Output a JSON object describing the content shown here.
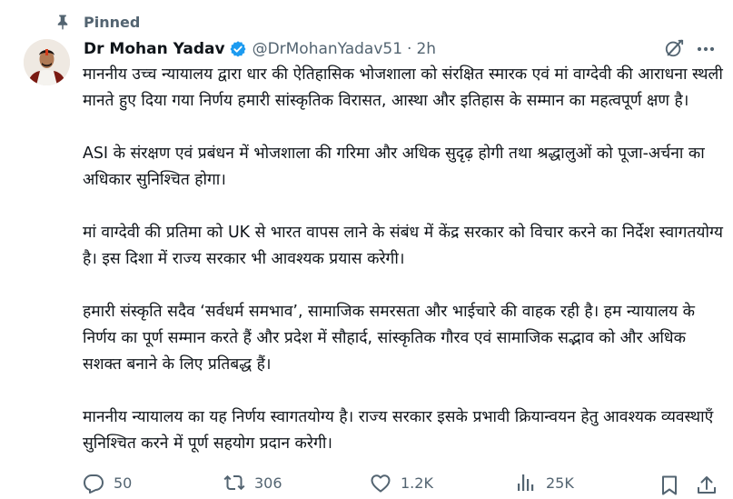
{
  "pinned": {
    "label": "Pinned"
  },
  "author": {
    "name": "Dr Mohan Yadav",
    "handle": "@DrMohanYadav51",
    "separator": "·",
    "time": "2h"
  },
  "tweet": {
    "paragraphs": [
      "माननीय उच्च न्यायालय द्वारा धार की ऐतिहासिक भोजशाला को संरक्षित स्मारक एवं मां वाग्देवी की आराधना स्थली मानते हुए दिया गया निर्णय हमारी सांस्कृतिक विरासत, आस्था और इतिहास के सम्मान का महत्वपूर्ण क्षण है।",
      "ASI के संरक्षण एवं प्रबंधन में भोजशाला की गरिमा और अधिक सुदृढ़ होगी तथा श्रद्धालुओं को पूजा-अर्चना का अधिकार सुनिश्चित होगा।",
      "मां वाग्देवी की प्रतिमा को UK से भारत वापस लाने के संबंध में केंद्र सरकार को विचार करने का निर्देश स्वागतयोग्य है। इस दिशा में राज्य सरकार भी आवश्यक प्रयास करेगी।",
      "हमारी संस्कृति सदैव ‘सर्वधर्म समभाव’, सामाजिक समरसता और भाईचारे की वाहक रही है। हम न्यायालय के निर्णय का पूर्ण सम्मान करते हैं और प्रदेश में सौहार्द, सांस्कृतिक गौरव एवं सामाजिक सद्भाव को और अधिक सशक्त बनाने के लिए प्रतिबद्ध हैं।",
      "माननीय न्यायालय का यह निर्णय स्वागतयोग्य है। राज्य सरकार इसके प्रभावी क्रियान्वयन हेतु आवश्यक व्यवस्थाएँ सुनिश्चित करने में पूर्ण सहयोग प्रदान करेगी।"
    ]
  },
  "actions": {
    "replies": "50",
    "reposts": "306",
    "likes": "1.2K",
    "views": "25K"
  },
  "icons": {
    "pin": "pin-icon",
    "verified": "verified-badge-icon",
    "grok": "grok-icon",
    "more": "more-icon",
    "reply": "reply-icon",
    "repost": "repost-icon",
    "like": "heart-icon",
    "views": "views-icon",
    "bookmark": "bookmark-icon",
    "share": "share-icon"
  },
  "colors": {
    "text": "#0f1419",
    "secondary": "#536471",
    "verified": "#1d9bf0"
  }
}
